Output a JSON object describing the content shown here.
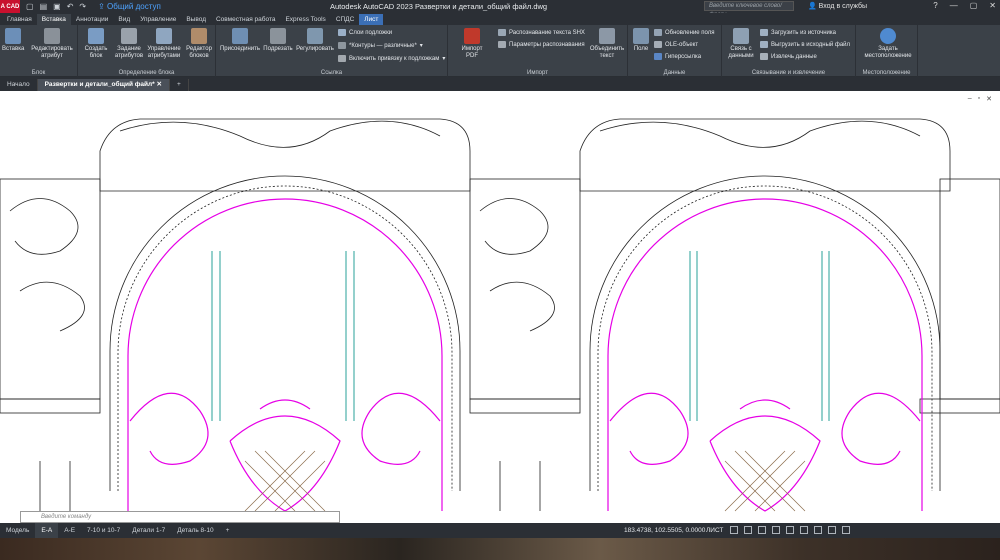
{
  "titlebar": {
    "share": "Общий доступ",
    "title": "Autodesk AutoCAD 2023   Развертки и детали_общий файл.dwg",
    "search_placeholder": "Введите ключевое слово/фразу",
    "signin": "Вход в службы",
    "logo": "A CAD"
  },
  "ribbon_tabs": [
    "Главная",
    "Вставка",
    "Аннотации",
    "Вид",
    "Управление",
    "Вывод",
    "Совместная работа",
    "Express Tools",
    "СПДС",
    "Лист"
  ],
  "active_tab": "Вставка",
  "ribbon": {
    "block": {
      "title": "Блок",
      "insert": "Вставка",
      "edit_attr": "Редактировать атрибут"
    },
    "block_def": {
      "title": "Определение блока",
      "create": "Создать блок",
      "define_attr": "Задание атрибутов",
      "manage_attr": "Управление атрибутами",
      "block_editor": "Редактор блоков"
    },
    "reference": {
      "title": "Ссылка",
      "attach": "Присоединить",
      "clip": "Подрезать",
      "adjust": "Регулировать",
      "underlay_layers": "Слои подложки",
      "frames": "*Контуры — различные*",
      "snap": "Включить привязку к подложкам"
    },
    "import": {
      "title": "Импорт",
      "import_pdf": "Импорт PDF",
      "shx": "Распознавание текста SHX",
      "recog_settings": "Параметры распознавания",
      "combine": "Объединить текст"
    },
    "data": {
      "title": "Данные",
      "field": "Поле",
      "update_fields": "Обновление поля",
      "ole": "OLE-объект",
      "hyperlink": "Гиперссылка"
    },
    "linking": {
      "title": "Связывание и извлечение",
      "data_link": "Связь с данными",
      "download": "Загрузить из источника",
      "upload": "Выгрузить в исходный файл",
      "extract": "Извлечь данные"
    },
    "location": {
      "title": "Местоположение",
      "set": "Задать местоположение"
    }
  },
  "doc_tabs": [
    "Начало",
    "Развертки и детали_общий файл*"
  ],
  "layout_tabs": [
    "Модель",
    "Е-А",
    "А-Е",
    "7-10 и 10-7",
    "Детали 1-7",
    "Деталь 8-10"
  ],
  "active_layout": "Е-А",
  "status": {
    "coords": "183.4738, 102.5505, 0.0000",
    "space": "ЛИСТ"
  },
  "command_placeholder": "Введите команду",
  "colors": {
    "accent": "#3b6fb6",
    "magenta": "#e600e6",
    "teal": "#2aa198"
  }
}
